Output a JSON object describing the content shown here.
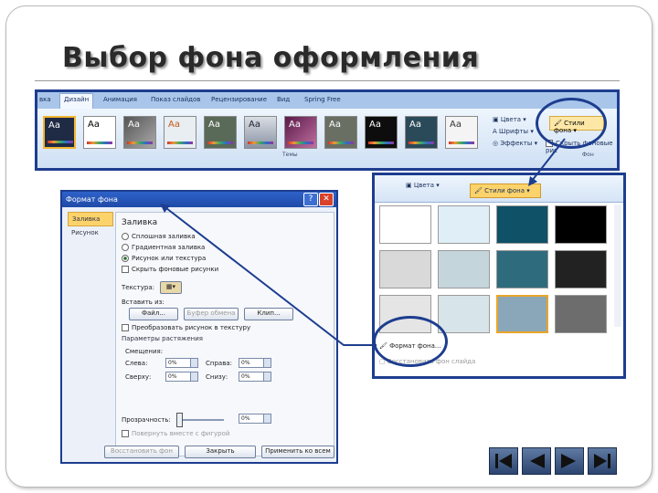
{
  "slide": {
    "title": "Выбор фона оформления"
  },
  "ribbon": {
    "tabs": [
      "вка",
      "Дизайн",
      "Анимация",
      "Показ слайдов",
      "Рецензирование",
      "Вид",
      "Spring Free"
    ],
    "active_tab": "Дизайн",
    "theme_thumbs": [
      "Aa",
      "Aa",
      "Aa",
      "Aa",
      "Aa",
      "Aa",
      "Aa",
      "Aa",
      "Aa",
      "Aa",
      "Aa"
    ],
    "group_themes": "Темы",
    "colors_label": "Цвета",
    "fonts_label": "Шрифты",
    "effects_label": "Эффекты",
    "bg_styles_button": "Стили фона",
    "hide_bg_checkbox": "Скрыть фоновые рис",
    "group_bg": "Фон"
  },
  "dialog": {
    "title": "Формат фона",
    "help": "?",
    "close": "✕",
    "sidebar": [
      "Заливка",
      "Рисунок"
    ],
    "section_fill": "Заливка",
    "fill_options": [
      "Сплошная заливка",
      "Градиентная заливка",
      "Рисунок или текстура"
    ],
    "selected_option": "Рисунок или текстура",
    "hide_bg_graphics": "Скрыть фоновые рисунки",
    "texture_label": "Текстура:",
    "insert_from": "Вставить из:",
    "file_button": "Файл...",
    "clipboard_button": "Буфер обмена",
    "clip_button": "Клип...",
    "tile_checkbox": "Преобразовать рисунок в текстуру",
    "stretch_options": "Параметры растяжения",
    "offsets": "Смещения:",
    "left_label": "Слева:",
    "left_value": "0%",
    "right_label": "Справа:",
    "right_value": "0%",
    "top_label": "Сверху:",
    "top_value": "0%",
    "bottom_label": "Снизу:",
    "bottom_value": "0%",
    "transparency_label": "Прозрачность:",
    "transparency_value": "0%",
    "rotate_with_shape": "Повернуть вместе с фигурой",
    "reset_button": "Восстановить фон",
    "close_button": "Закрыть",
    "apply_all_button": "Применить ко всем"
  },
  "dropdown": {
    "colors_label": "Цвета",
    "bg_styles_button": "Стили фона",
    "swatch_colors": [
      "#ffffff",
      "#dfeef7",
      "#0f5166",
      "#000000",
      "#d9d9d9",
      "#c5d5dc",
      "#2e6b7d",
      "#222222",
      "#e5e5e5",
      "#d7e4ea",
      "#8aa6b9",
      "#6d6d6d"
    ],
    "menu_format": "Формат фона...",
    "menu_reset": "Восстановить фон слайда"
  },
  "nav": {
    "first": "first",
    "prev": "prev",
    "next": "next",
    "last": "last"
  }
}
